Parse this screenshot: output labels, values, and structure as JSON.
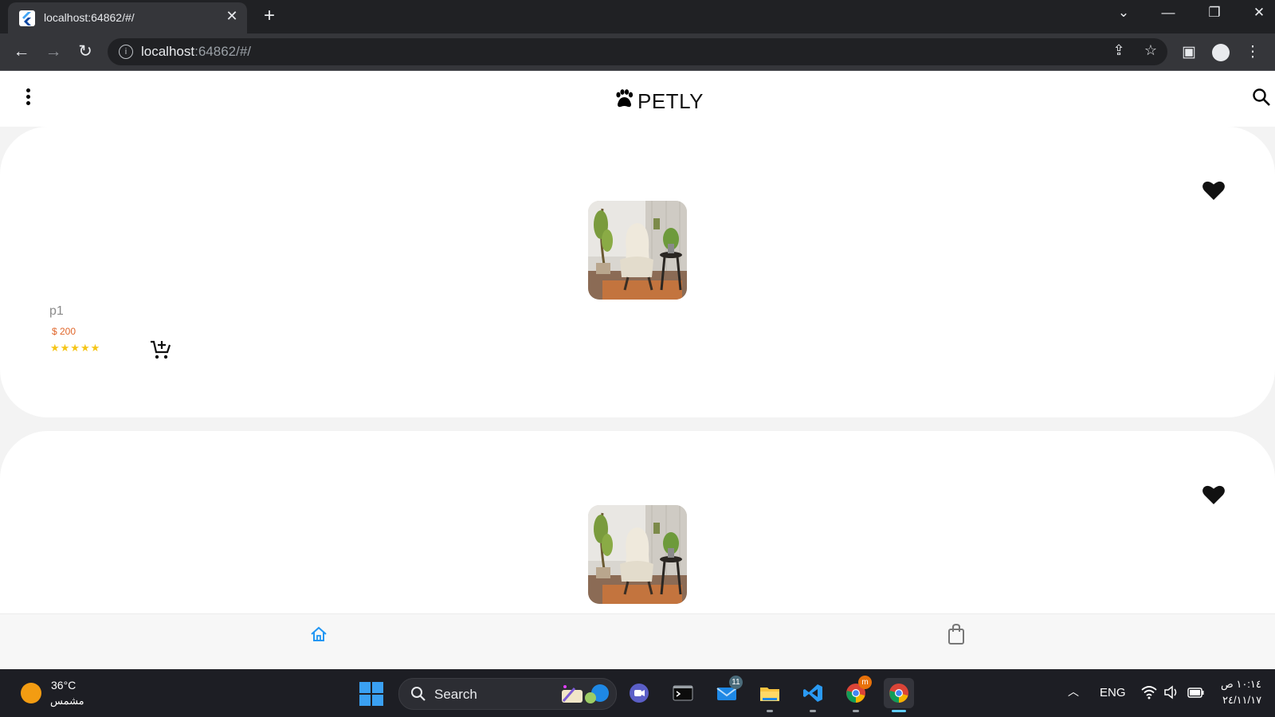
{
  "browser": {
    "tab_title": "localhost:64862/#/",
    "url_host": "localhost",
    "url_rest": ":64862/#/",
    "icons": [
      "flutter-favicon",
      "close-icon",
      "plus-icon",
      "chevron-down-icon",
      "minimize-icon",
      "restore-icon",
      "close-window-icon",
      "back-icon",
      "forward-icon",
      "reload-icon",
      "info-icon",
      "share-icon",
      "star-icon",
      "side-panel-icon",
      "profile-icon",
      "kebab-menu-icon"
    ]
  },
  "app": {
    "brand": "PETLY",
    "icons": [
      "more-vert-icon",
      "paw-icon",
      "search-icon"
    ],
    "products": [
      {
        "name": "p1",
        "price": "$ 200",
        "rating": 5,
        "stars": "★★★★★",
        "favorite": true
      },
      {
        "name": "",
        "price": "",
        "rating": 0,
        "stars": "",
        "favorite": true
      }
    ],
    "bottom_nav": [
      {
        "icon": "home-icon",
        "active": true
      },
      {
        "icon": "shopping-bag-icon",
        "active": false
      }
    ]
  },
  "taskbar": {
    "weather_temp": "36°C",
    "weather_desc": "مشمس",
    "search_label": "Search",
    "mail_badge": "11",
    "chrome_badge": "m",
    "lang": "ENG",
    "time": "١٠:١٤ ص",
    "date": "٢٤/١١/١٧",
    "apps": [
      "windows-start-icon",
      "search-icon",
      "teams-chat-icon",
      "terminal-icon",
      "mail-icon",
      "file-explorer-icon",
      "vscode-icon",
      "chrome-icon",
      "chrome-icon"
    ],
    "tray_icons": [
      "chevron-up-icon",
      "wifi-icon",
      "volume-icon",
      "battery-icon"
    ]
  },
  "colors": {
    "price": "#e0662a",
    "stars": "#f5c518",
    "active_nav": "#2196f3",
    "taskbar": "#1d1e24",
    "chrome_dark": "#202124"
  }
}
